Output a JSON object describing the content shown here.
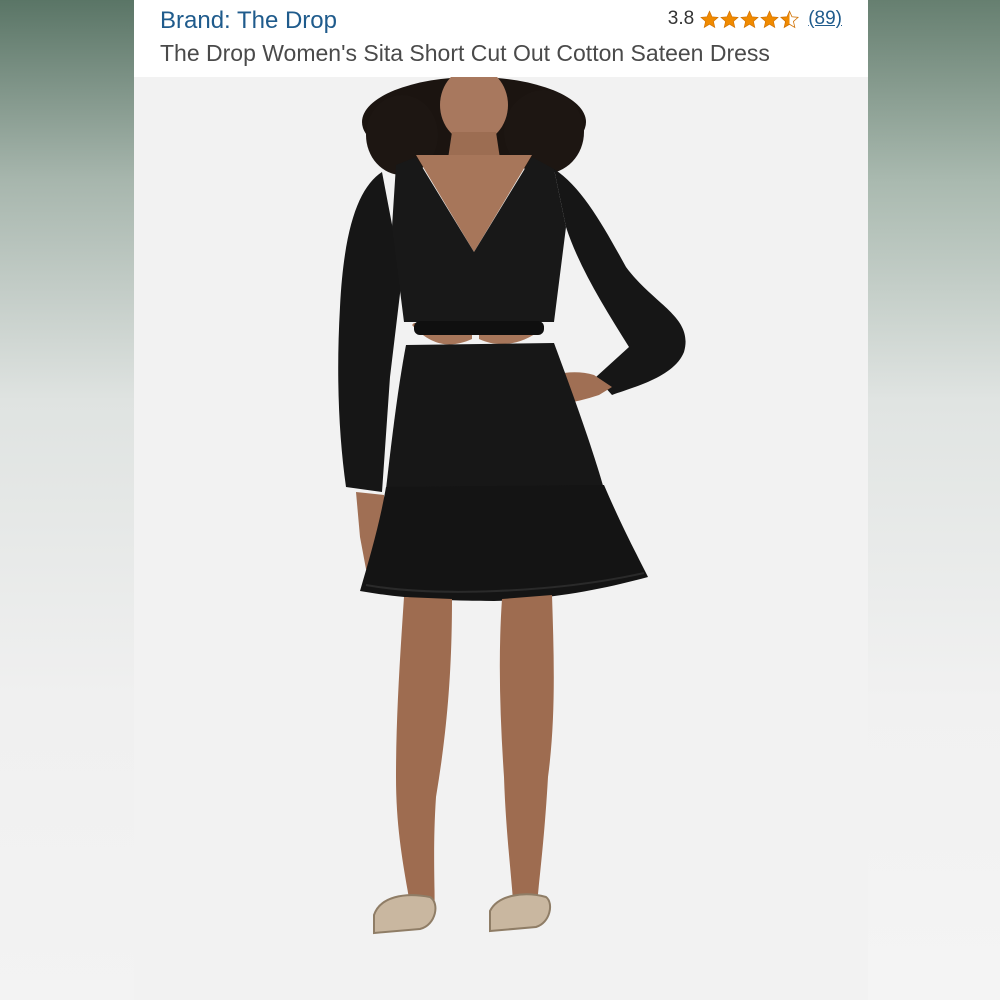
{
  "listing": {
    "brand_link": "Brand: The Drop",
    "rating_value": "3.8",
    "rating_stars": 3.8,
    "rating_max": 5,
    "review_count": "(89)",
    "product_title": "The Drop Women's Sita Short Cut Out Cotton Sateen Dress"
  },
  "icons": {
    "star": "star-icon",
    "star_half": "half-star-icon"
  },
  "colors": {
    "link": "#1f5b8c",
    "star": "#f08a00",
    "dress": "#151515",
    "background": "#f1f1f1"
  }
}
